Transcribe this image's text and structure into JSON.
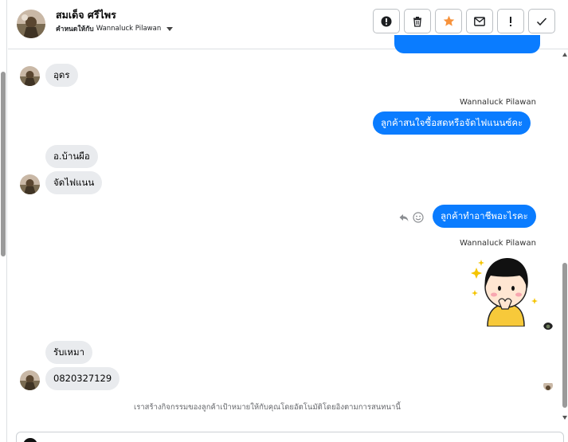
{
  "contact": {
    "name": "สมเด็จ ศรีไพร",
    "assign_label": "คำหนดให้กับ",
    "assignee": "Wannaluck Pilawan"
  },
  "toolbar": {
    "buttons": [
      {
        "name": "alert-circle-button",
        "icon": "exclamation-circle-icon"
      },
      {
        "name": "delete-button",
        "icon": "trash-icon"
      },
      {
        "name": "star-button",
        "icon": "star-icon",
        "color": "#f7923b"
      },
      {
        "name": "email-button",
        "icon": "envelope-icon"
      },
      {
        "name": "important-button",
        "icon": "exclamation-icon"
      },
      {
        "name": "done-button",
        "icon": "check-icon"
      }
    ]
  },
  "messages": {
    "m1": "อุดร",
    "sender1": "Wannaluck Pilawan",
    "m2": "ลูกค้าสนใจซื้อสดหรือจัดไฟแนนซ์คะ",
    "m3": "อ.บ้านผือ",
    "m4": "จัดไฟแนน",
    "m5": "ลูกค้าทำอาชีพอะไรคะ",
    "sender2": "Wannaluck Pilawan",
    "m6": "รับเหมา",
    "m7": "0820327129"
  },
  "notice": "เราสร้างกิจกรรมของลูกค้าเป้าหมายให้กับคุณโดยอัตโนมัติโดยอิงตามการสนทนานี้",
  "colors": {
    "outgoing_bubble": "#0a7cff",
    "incoming_bubble": "#e9ebee",
    "star": "#f7923b"
  }
}
